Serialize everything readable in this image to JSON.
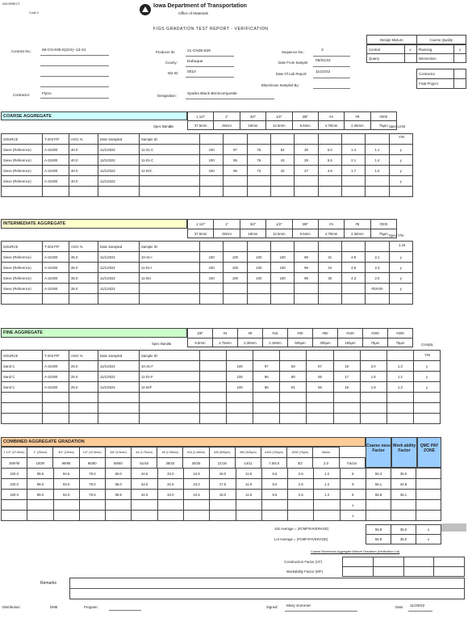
{
  "header": {
    "topleft1": "INCORRECT:",
    "topleft2": "Code 0",
    "dept": "Iowa Department of Transportation",
    "office": "Office of Materials",
    "title": "FIGS GRADATION TEST REPORT - VERIFICATION"
  },
  "corner": {
    "c1": "Design Mixture",
    "c2": "Course Quality",
    "r1a": "Central",
    "r1b": "x",
    "r1c": "Planning",
    "r1d": "x",
    "r2a": "Quarry",
    "r2c": "Intersection",
    "r3c": "Contractor",
    "r4c": "Final Project"
  },
  "fields": {
    "contract_lbl": "Contract No.:",
    "contract_val": "IM-CN-035-6(224)--13-31",
    "contractor_lbl": "Contractor:",
    "contractor_val": "Flynn",
    "project_lbl": "Producer ID:",
    "project_val": "21-CN35-529",
    "county_lbl": "County:",
    "county_val": "Dubuque",
    "mixid_lbl": "Mix ID:",
    "mixid_val": "0010",
    "designation_lbl": "Designation:",
    "designation_val": "Sparks Black Brickcomposite",
    "sequence_lbl": "Sequence No.:",
    "sequence_val": "3",
    "datefrom_lbl": "Date From Sample:",
    "datefrom_val": "09/21/22",
    "dateto_lbl": "Date Of Lab Report:",
    "dateto_val": "11/22/22",
    "material_lbl": "Bituminous Sampled By:",
    "material_val": ""
  },
  "coarse": {
    "title": "COARSE AGGREGATE",
    "sieves": [
      "1 1/2\"",
      "1\"",
      "3/4\"",
      "1/2\"",
      "3/8\"",
      "#4",
      "#8",
      "#200"
    ],
    "sizes": [
      "37.5mm",
      "25mm",
      "19mm",
      "12.5mm",
      "9.5mm",
      "4.75mm",
      "2.36mm",
      "75µm"
    ],
    "specs_lbl": "Spec Bandss",
    "specs_x": "x",
    "spec_col": "Spec Limit",
    "spec_sub": "Y/N",
    "cols": [
      "SOURCE",
      "T-203 P/F",
      "AGG %",
      "Date Sampled",
      "Sample ID"
    ],
    "rows": [
      [
        "Sieve (Reference)",
        "A-31000",
        "40.0",
        "11/1/2022",
        "11-31-C",
        "100",
        "97",
        "76",
        "52",
        "30",
        "6.0",
        "1.4",
        "1.1",
        "y"
      ],
      [
        "Sieve (Reference)",
        "A-31000",
        "40.0",
        "11/1/2022",
        "11-01-C",
        "100",
        "95",
        "76",
        "43",
        "28",
        "5.5",
        "2.1",
        "1.4",
        "y"
      ],
      [
        "Sieve (Reference)",
        "A-31000",
        "40.0",
        "11/1/2022",
        "11-02C",
        "100",
        "96",
        "73",
        "42",
        "27",
        "4.8",
        "1.7",
        "1.0",
        "y"
      ],
      [
        "Sieve (Reference)",
        "A-31000",
        "40.0",
        "11/1/2022",
        "",
        "",
        "",
        "",
        "",
        "",
        "",
        "",
        "",
        "y"
      ]
    ]
  },
  "inter": {
    "title": "INTERMEDIATE AGGREGATE",
    "sieves": [
      "1 1/2\"",
      "1\"",
      "3/4\"",
      "1/2\"",
      "3/8\"",
      "#4",
      "#8",
      "#200"
    ],
    "sizes": [
      "37.5mm",
      "25mm",
      "19mm",
      "12.5mm",
      "9.5mm",
      "4.75mm",
      "2.36mm",
      "75µm"
    ],
    "spec_col": "Spec Y/N",
    "spec_sub": "1.15",
    "cols": [
      "SOURCE",
      "T-203 P/F",
      "AGG %",
      "Date Sampled",
      "Sample ID"
    ],
    "rows": [
      [
        "Sieve (Reference)",
        "A-31000",
        "35.0",
        "11/1/2022",
        "10-31-I",
        "100",
        "100",
        "100",
        "100",
        "98",
        "31",
        "4.6",
        "2.1",
        "y"
      ],
      [
        "Sieve (Reference)",
        "A-31000",
        "35.0",
        "11/1/2022",
        "11-01-I",
        "100",
        "100",
        "100",
        "100",
        "99",
        "34",
        "4.8",
        "2.3",
        "y"
      ],
      [
        "Sieve (Reference)",
        "A-31000",
        "35.0",
        "11/1/2022",
        "11-02I",
        "100",
        "100",
        "100",
        "100",
        "98",
        "30",
        "4.3",
        "2.0",
        "y"
      ],
      [
        "Sieve (Reference)",
        "A-31000",
        "35.0",
        "11/1/2022",
        "",
        "",
        "",
        "",
        "",
        "",
        "",
        "",
        "#DIV/0!",
        "y"
      ]
    ]
  },
  "fine": {
    "title": "FINE AGGREGATE",
    "sieves": [
      "3/8\"",
      "#4",
      "#8",
      "#16",
      "#30",
      "#50",
      "#100",
      "#200",
      "#200"
    ],
    "sizes": [
      "9.5mm",
      "4.75mm",
      "2.36mm",
      "1.18mm",
      "600µm",
      "300µm",
      "150µm",
      "75µm",
      "75µm"
    ],
    "specs_lbl": "Spec Bands",
    "specs_x": "x",
    "spec_col": "Comply",
    "spec_sub": "Y/N",
    "cols": [
      "SOURCE",
      "T-203 P/F",
      "AGG %",
      "Date Sampled",
      "Sample ID"
    ],
    "rows": [
      [
        "Sand C",
        "A-31000",
        "25.0",
        "11/1/2022",
        "10-31-F",
        "",
        "100",
        "97",
        "83",
        "57",
        "18",
        "2.0",
        "1.3",
        "y"
      ],
      [
        "Sand C",
        "A-31000",
        "25.0",
        "11/1/2022",
        "11-01-F",
        "",
        "100",
        "96",
        "80",
        "55",
        "17",
        "1.8",
        "1.2",
        "y"
      ],
      [
        "Sand C",
        "A-31000",
        "25.0",
        "11/1/2022",
        "11-02F",
        "",
        "100",
        "96",
        "81",
        "56",
        "18",
        "1.9",
        "1.3",
        "y"
      ]
    ]
  },
  "comb": {
    "title": "COMBINED AGGREGATE GRADATION",
    "hdr": [
      "1 1/2\" (37.5mm)",
      "1\" (25mm)",
      "3/4\" (19mm)",
      "1/2\" (12.5mm)",
      "3/8\" (9.5mm)",
      "#4 (4.75mm)",
      "#8 (2.36mm)",
      "#16 (1.18mm)",
      "#30 (600µm)",
      "#50 (300µm)",
      "#100 (150µm)",
      "#200 (75µm)",
      "Works"
    ],
    "sub": [
      "JMF/M",
      "100/0",
      "99/95",
      "86/80",
      "68/60",
      "51/45",
      "38/33",
      "30/26",
      "21/18",
      "14/11",
      "7.5/5.5",
      "3/2",
      "2.0",
      "Factor"
    ],
    "coarse_hdr": "Coarse ness Factor",
    "work_hdr": "Work ability Factor",
    "qmc_hdr": "QMC PAY ZONE",
    "rows": [
      [
        "100.0",
        "99.5",
        "94.5",
        "79.0",
        "60.0",
        "44.5",
        "33.0",
        "24.5",
        "18.0",
        "11.5",
        "5.5",
        "2.5",
        "1.2",
        "8",
        "55.3",
        "35.0",
        ""
      ],
      [
        "100.0",
        "99.0",
        "93.0",
        "78.0",
        "58.0",
        "43.0",
        "32.5",
        "24.0",
        "17.5",
        "11.0",
        "5.0",
        "2.5",
        "1.3",
        "9",
        "56.1",
        "34.8",
        ""
      ],
      [
        "100.0",
        "99.0",
        "94.0",
        "78.5",
        "59.5",
        "44.0",
        "33.0",
        "24.5",
        "18.0",
        "11.5",
        "5.5",
        "2.5",
        "1.3",
        "8",
        "55.8",
        "35.1",
        ""
      ],
      [
        "",
        "",
        "",
        "",
        "",
        "",
        "",
        "",
        "",
        "",
        "",
        "",
        "",
        "x",
        "",
        "",
        ""
      ],
      [
        "",
        "",
        "",
        "",
        "",
        "",
        "",
        "",
        "",
        "",
        "",
        "",
        "",
        "x",
        "",
        "",
        ""
      ]
    ],
    "avg1_lbl": "Job Average = (#CMF/#AVERAGE)",
    "avg1_a": "55.8",
    "avg1_b": "35.0",
    "avg1_c": "x",
    "avg2_lbl": "Lot Average = (#CMF/#AVERAGE)",
    "avg2_a": "55.8",
    "avg2_b": "35.0",
    "avg2_c": "x",
    "note": "Coarse Bituminous Aggregate Mixture Gradation (Verification Lot)",
    "f1": "Construction Factor (CF)",
    "f2": "Workability Factor (WF)"
  },
  "footer": {
    "remarks": "Remarks",
    "dist_lbl": "Distribution:",
    "dist_val": "DME",
    "prog_lbl": "Program:",
    "prog_val": "",
    "signed_lbl": "Signed:",
    "signed_val": "Mary Sommer",
    "date_lbl": "Date:",
    "date_val": "11/29/22"
  }
}
